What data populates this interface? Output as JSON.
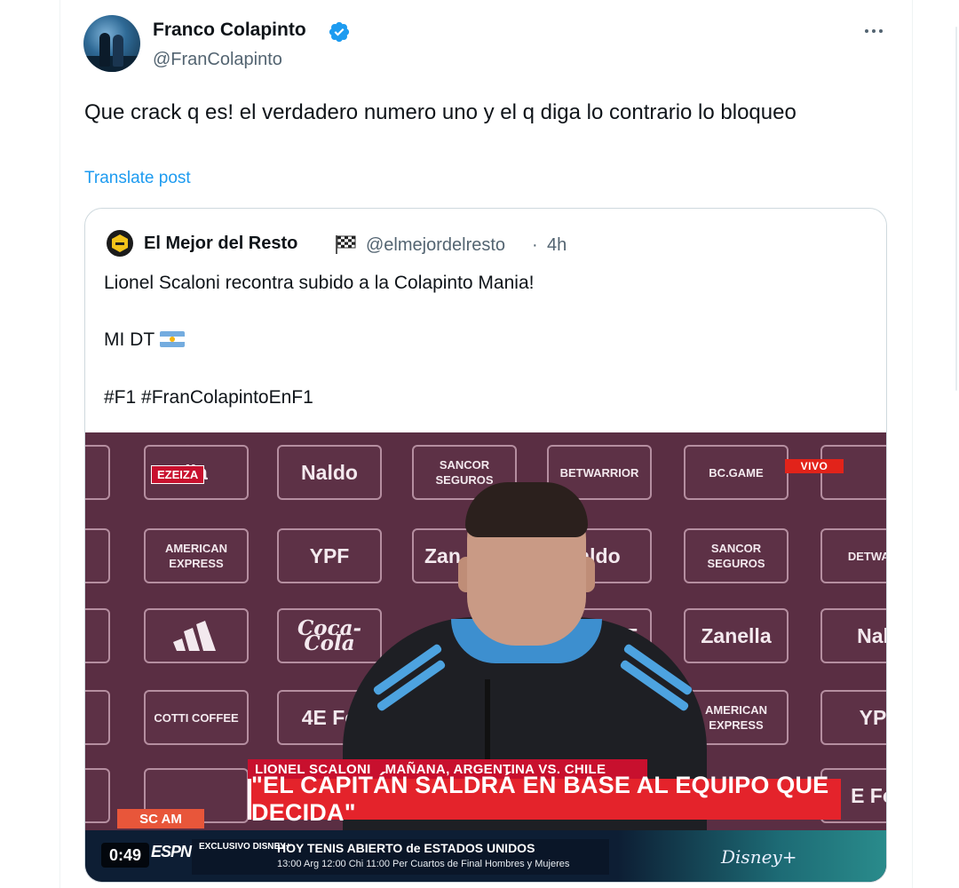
{
  "tweet": {
    "author_name": "Franco Colapinto",
    "author_handle": "@FranColapinto",
    "text": "Que crack q es! el verdadero numero uno y el q diga lo contrario lo bloqueo",
    "translate_label": "Translate post"
  },
  "quoted": {
    "author_name": "El Mejor del Resto",
    "author_handle": "@elmejordelresto",
    "separator": "·",
    "time": "4h",
    "line1": "Lionel Scaloni recontra subido a la Colapinto Mania!",
    "line2": "MI DT",
    "line3": "#F1 #FranColapintoEnF1"
  },
  "video": {
    "live_badge": "VIVO",
    "location_badge": "EZEIZA",
    "lower_third_name": "LIONEL SCALONI",
    "lower_third_tag": "MAÑANA, ARGENTINA VS. CHILE",
    "headline": "\"EL CAPITÁN SALDRÁ EN BASE AL EQUIPO QUE DECIDA\"",
    "show_badge": "SC AM",
    "timecode": "0:49",
    "network": "ESPN",
    "ticker_exclusive": "EXCLUSIVO DISNEY+",
    "ticker_line1": "HOY   TENIS   ABIERTO de ESTADOS UNIDOS",
    "ticker_line2": "13:00 Arg   12:00 Chi   11:00 Per   Cuartos de Final   Hombres y Mujeres",
    "disney_logo": "Disney+",
    "sponsors": {
      "s1": "lla",
      "s2": "Naldo",
      "s3": "SANCOR SEGUROS",
      "s4": "BETWARRIOR",
      "s5": "BC.GAME",
      "s6": "AMERICAN EXPRESS",
      "s7": "YPF",
      "s8": "Zan",
      "s9": "aldo",
      "s10": "SANCOR SEGUROS",
      "s11": "DETWAR",
      "s12": "Coca-Cola",
      "s13": "PF",
      "s14": "Zanella",
      "s15": "Nal",
      "s16": "COTTI COFFEE",
      "s17": "4E Fo",
      "s18": "AMERICAN EXPRESS",
      "s19": "YP",
      "s20": "E Fo"
    }
  },
  "colors": {
    "link": "#1d9bf0",
    "verified": "#1d9bf0",
    "secondary_text": "#536471",
    "border": "#cfd9de",
    "banner_red": "#e4232b"
  },
  "icons": [
    "verified-badge-icon",
    "more-icon",
    "checkered-flag-icon",
    "argentina-flag-icon"
  ]
}
